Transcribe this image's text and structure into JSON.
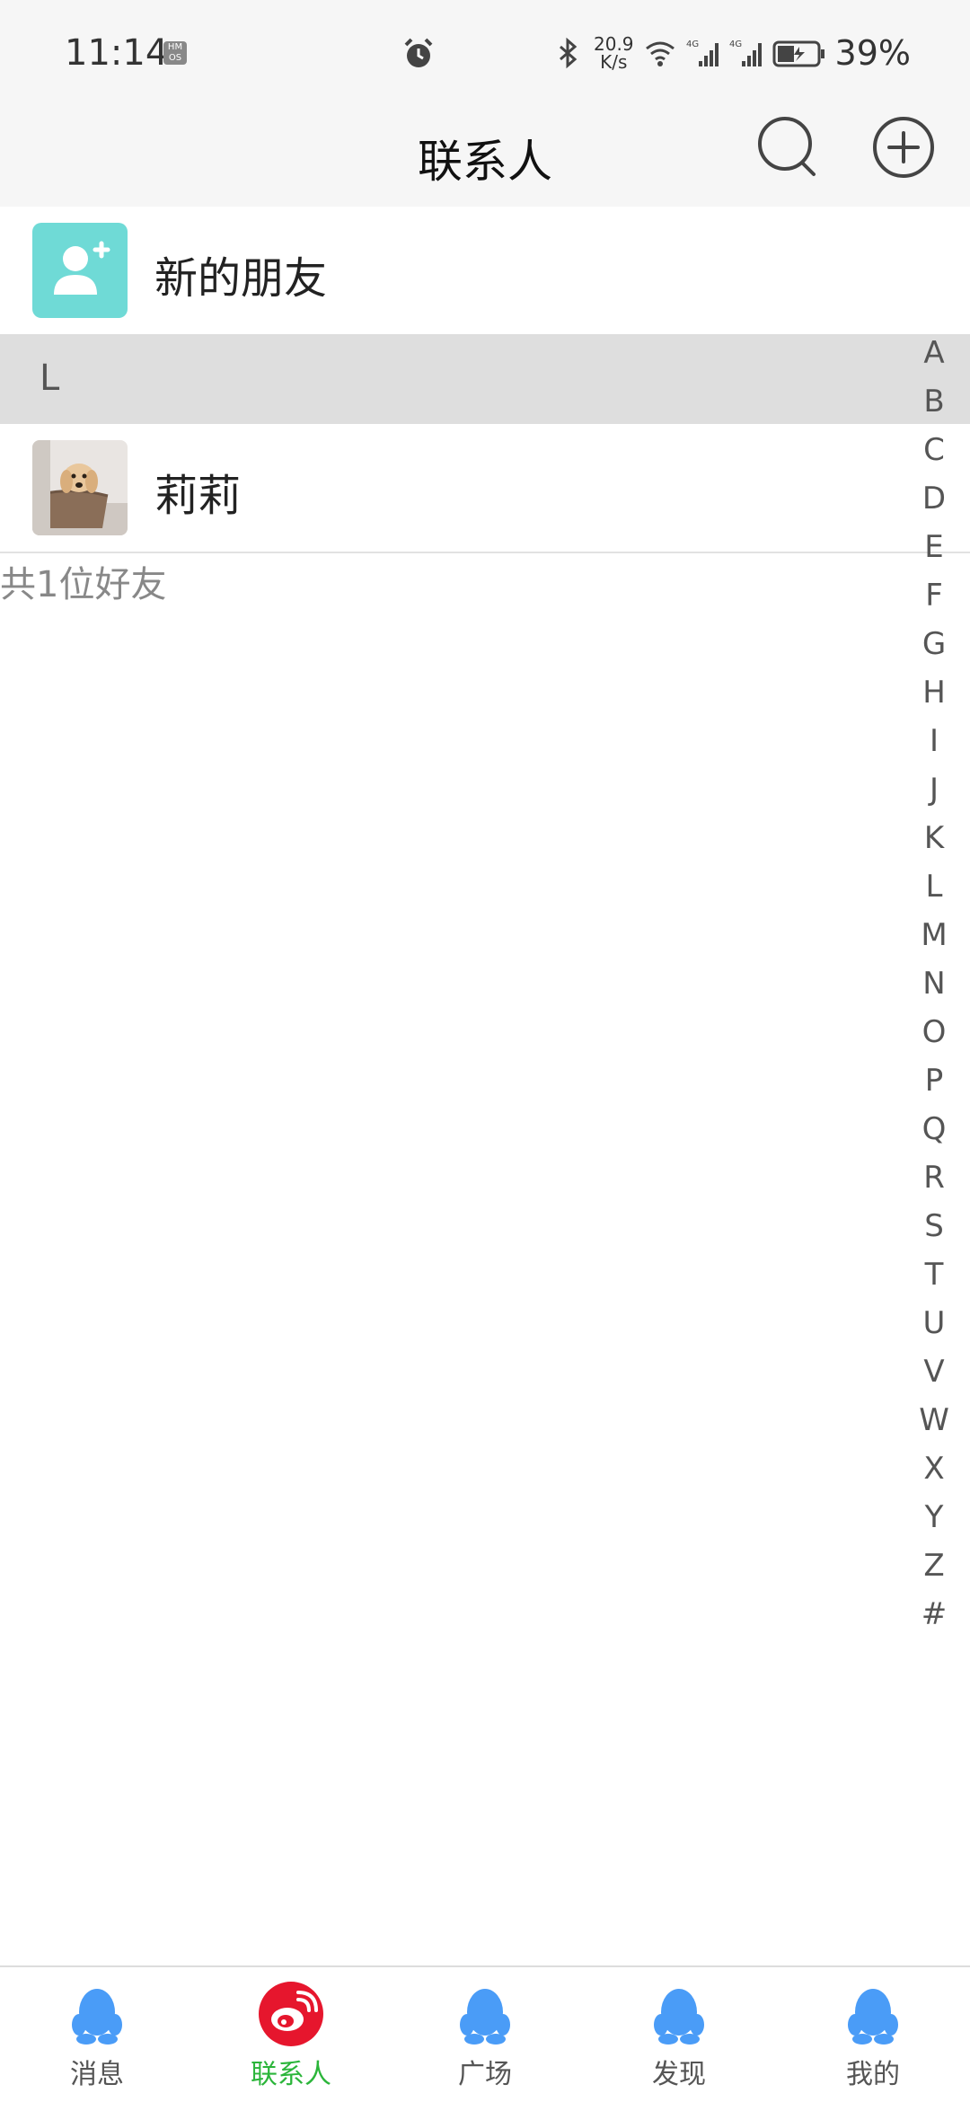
{
  "status_bar": {
    "time": "11:14",
    "hm_badge": "HM OS",
    "speed_value": "20.9",
    "speed_unit": "K/s",
    "battery": "39%"
  },
  "header": {
    "title": "联系人"
  },
  "new_friends": {
    "label": "新的朋友",
    "icon": "add-user-icon",
    "color": "#6fdad6"
  },
  "sections": [
    {
      "letter": "L",
      "contacts": [
        {
          "name": "莉莉",
          "avatar": "dog-photo"
        }
      ]
    }
  ],
  "total_count": "共1位好友",
  "alphabet": [
    "A",
    "B",
    "C",
    "D",
    "E",
    "F",
    "G",
    "H",
    "I",
    "J",
    "K",
    "L",
    "M",
    "N",
    "O",
    "P",
    "Q",
    "R",
    "S",
    "T",
    "U",
    "V",
    "W",
    "X",
    "Y",
    "Z",
    "#"
  ],
  "tabs": [
    {
      "label": "消息",
      "icon": "qq-penguin-icon",
      "active": false
    },
    {
      "label": "联系人",
      "icon": "weibo-icon",
      "active": true
    },
    {
      "label": "广场",
      "icon": "qq-penguin-icon",
      "active": false
    },
    {
      "label": "发现",
      "icon": "qq-penguin-icon",
      "active": false
    },
    {
      "label": "我的",
      "icon": "qq-penguin-icon",
      "active": false
    }
  ],
  "colors": {
    "accent_green": "#2bb53a",
    "penguin_blue": "#4a9cf7",
    "weibo_red": "#e6162d"
  }
}
